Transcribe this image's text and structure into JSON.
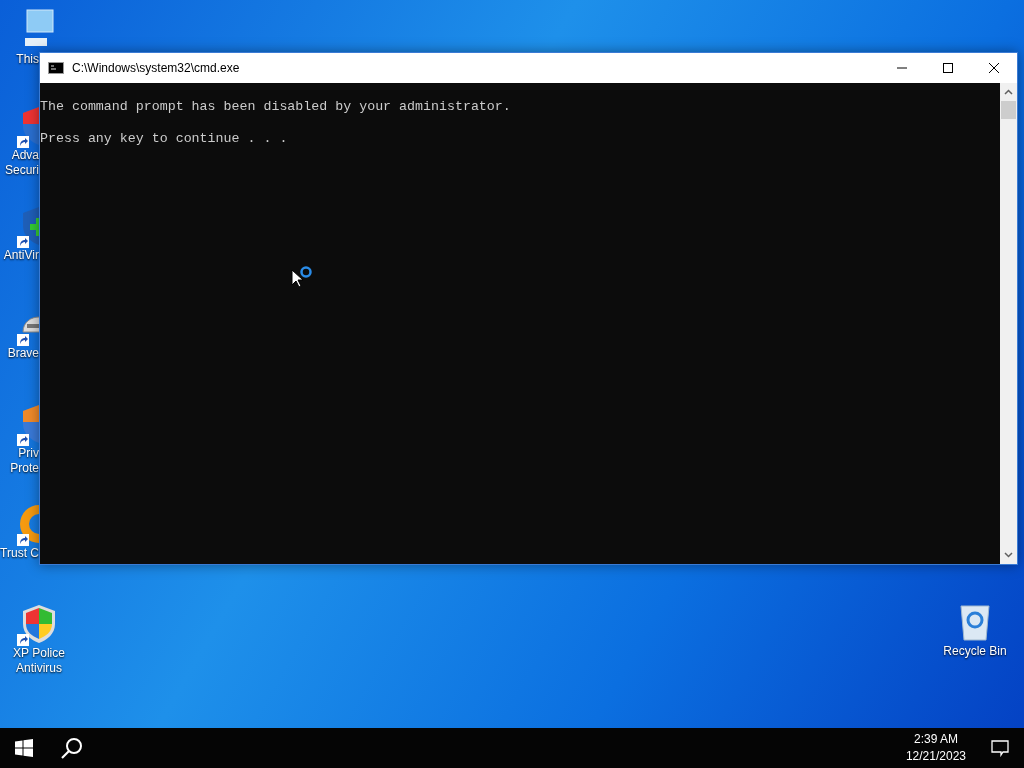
{
  "desktop_icons": [
    {
      "kind": "monitor",
      "lines": [
        "This"
      ],
      "shortcut": false
    },
    {
      "kind": "shield_red",
      "lines": [
        "Adva",
        "Securi"
      ],
      "shortcut": true
    },
    {
      "kind": "shield_green",
      "lines": [
        "AntiVir"
      ],
      "shortcut": true
    },
    {
      "kind": "helmet",
      "lines": [
        "Brave"
      ],
      "shortcut": true
    },
    {
      "kind": "shield_orange",
      "lines": [
        "Priv",
        "Prote"
      ],
      "shortcut": true
    },
    {
      "kind": "ring",
      "lines": [
        "Trust C"
      ],
      "shortcut": true
    },
    {
      "kind": "shield_color",
      "lines": [
        "XP Police",
        "Antivirus"
      ],
      "shortcut": true
    }
  ],
  "recycle_bin": {
    "label": "Recycle Bin"
  },
  "window": {
    "title": "C:\\Windows\\system32\\cmd.exe",
    "lines": [
      "The command prompt has been disabled by your administrator.",
      "Press any key to continue . . ."
    ]
  },
  "taskbar": {
    "time": "2:39 AM",
    "date": "12/21/2023"
  }
}
